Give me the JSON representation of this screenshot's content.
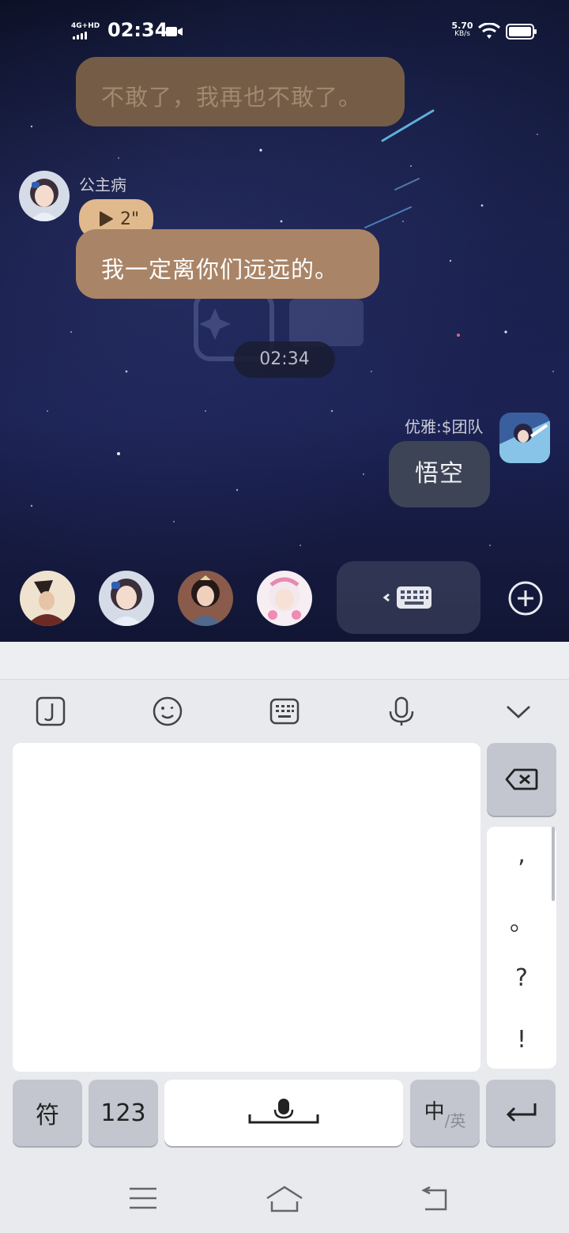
{
  "status_bar": {
    "network": "4G+HD",
    "time": "02:34",
    "net_speed_value": "5.70",
    "net_speed_unit": "KB/s"
  },
  "chat": {
    "faded_message": "不敢了，我再也不敢了。",
    "sender_name": "公主病",
    "voice_duration": "2\"",
    "message": "我一定离你们远远的。",
    "timestamp": "02:34",
    "self_name": "优雅:$团队",
    "self_message": "悟空"
  },
  "keyboard": {
    "symbol_key": "符",
    "number_key": "123",
    "lang_key_primary": "中",
    "lang_key_secondary": "/英",
    "punctuation": [
      ",",
      "。",
      "?",
      "!"
    ]
  },
  "colors": {
    "accent_bubble": "#a98466",
    "voice_chip": "#e0b98d",
    "keyboard_bg": "#e9eaee"
  }
}
